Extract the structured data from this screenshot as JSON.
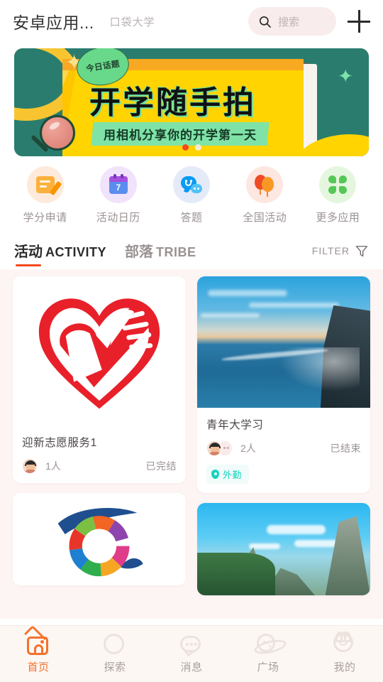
{
  "header": {
    "app_title": "安卓应用...",
    "org_name": "口袋大学",
    "search_placeholder": "搜索",
    "search_icon": "search-icon",
    "add_icon": "plus-icon"
  },
  "banner": {
    "badge": "今日话题",
    "title": "开学随手拍",
    "subtitle": "用相机分享你的开学第一天",
    "dots": 2,
    "active_dot": 0,
    "colors": {
      "teal": "#2a7d6e",
      "yellow": "#ffd400",
      "red": "#d8341f",
      "green": "#7fe3a8",
      "dot_active": "#f4491e"
    }
  },
  "quick_actions": [
    {
      "label": "学分申请",
      "icon": "note-pen-icon",
      "bg": "#fdeadb"
    },
    {
      "label": "活动日历",
      "icon": "calendar-icon",
      "day": "7",
      "bg": "#f0e3fb"
    },
    {
      "label": "答题",
      "icon": "chat-faces-icon",
      "bg": "#e4eaf8"
    },
    {
      "label": "全国活动",
      "icon": "balloons-icon",
      "bg": "#fde7e0"
    },
    {
      "label": "更多应用",
      "icon": "clover-icon",
      "bg": "#e5f6de"
    }
  ],
  "tabs": {
    "items": [
      {
        "cn": "活动",
        "en": "ACTIVITY",
        "active": true
      },
      {
        "cn": "部落",
        "en": "TRIBE",
        "active": false
      }
    ],
    "filter_label": "FILTER",
    "filter_icon": "funnel-icon"
  },
  "cards": [
    {
      "title": "迎新志愿服务1",
      "count": "1人",
      "status": "已完结",
      "media": "volunteer-heart-hand-logo",
      "avatars": 1,
      "more_avatars": false,
      "tag": null
    },
    {
      "title": "青年大学习",
      "count": "2人",
      "status": "已结束",
      "media": "ocean-coast-photo",
      "avatars": 1,
      "more_avatars": true,
      "tag": {
        "label": "外勤",
        "icon": "location-pin-icon",
        "color": "#16d3bd"
      }
    },
    {
      "title": "",
      "count": "",
      "status": "",
      "media": "colorful-ring-logo",
      "avatars": 0,
      "more_avatars": false,
      "tag": null
    },
    {
      "title": "",
      "count": "",
      "status": "",
      "media": "mountain-landscape-photo",
      "avatars": 0,
      "more_avatars": false,
      "tag": null
    }
  ],
  "bottom_nav": {
    "items": [
      {
        "label": "首页",
        "icon": "home-icon",
        "active": true
      },
      {
        "label": "探索",
        "icon": "compass-icon",
        "active": false
      },
      {
        "label": "消息",
        "icon": "chat-icon",
        "active": false
      },
      {
        "label": "广场",
        "icon": "planet-icon",
        "active": false
      },
      {
        "label": "我的",
        "icon": "face-icon",
        "active": false
      }
    ],
    "active_color": "#f4722b",
    "inactive_color": "#a89f9b"
  }
}
